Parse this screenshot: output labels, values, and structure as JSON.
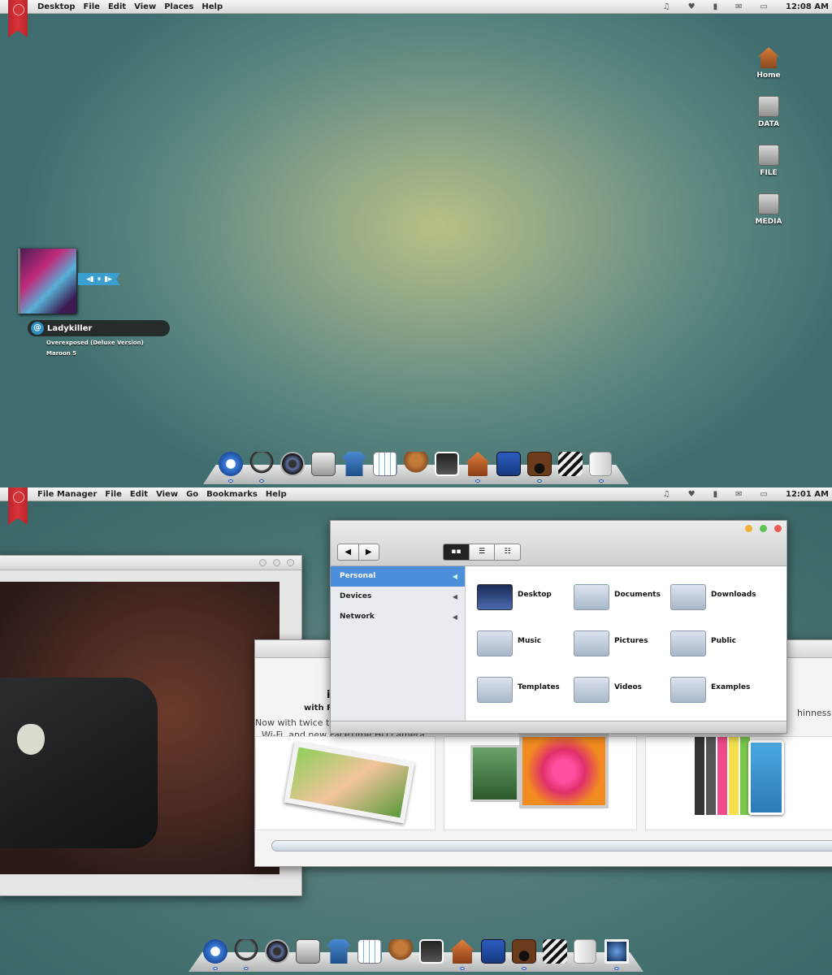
{
  "screen1": {
    "menubar": {
      "items": [
        "Desktop",
        "File",
        "Edit",
        "View",
        "Places",
        "Help"
      ],
      "tray_icons": [
        "music-icon",
        "heart-icon",
        "signal-icon",
        "mail-icon",
        "chat-icon"
      ],
      "clock": "12:08 AM"
    },
    "desktop_icons": [
      {
        "label": "Home",
        "icon": "home-folder-icon"
      },
      {
        "label": "DATA",
        "icon": "drive-icon"
      },
      {
        "label": "FILE",
        "icon": "drive-icon"
      },
      {
        "label": "MEDIA",
        "icon": "drive-icon"
      }
    ],
    "music_widget": {
      "track": "Ladykiller",
      "album": "Overexposed (Deluxe Version)",
      "artist": "Maroon 5",
      "controls": [
        "previous-icon",
        "pause-icon",
        "next-icon"
      ]
    },
    "dock": {
      "items": [
        "safari-icon",
        "headphones-icon",
        "webcam-icon",
        "window-manager-icon",
        "shirt-icon",
        "calendar-grid-icon",
        "teddy-bear-icon",
        "photos-icon",
        "home-icon",
        "superman-book-icon",
        "speaker-icon",
        "clapperboard-icon",
        "switch-icon"
      ],
      "running": [
        0,
        1,
        8,
        10,
        12
      ]
    }
  },
  "screen2": {
    "menubar": {
      "items": [
        "File Manager",
        "File",
        "Edit",
        "View",
        "Go",
        "Bookmarks",
        "Help"
      ],
      "tray_icons": [
        "music-icon",
        "heart-icon",
        "signal-icon",
        "mail-icon",
        "chat-icon"
      ],
      "clock": "12:01 AM"
    },
    "store_window": {
      "headline_partial": "iP",
      "subhead_partial": "with Re",
      "body_line1": "Now with twice th",
      "body_line2": "Wi-Fi, and new FaceTime HD camera.",
      "right_text": "hinness."
    },
    "file_manager": {
      "nav": [
        "back-arrow-icon",
        "forward-arrow-icon"
      ],
      "view_modes": [
        "icon-view-icon",
        "list-view-icon",
        "compact-view-icon"
      ],
      "sidebar": [
        {
          "label": "Personal",
          "selected": true
        },
        {
          "label": "Devices",
          "selected": false
        },
        {
          "label": "Network",
          "selected": false
        }
      ],
      "folders": [
        {
          "label": "Desktop",
          "icon": "desktop-folder-icon"
        },
        {
          "label": "Documents",
          "icon": "documents-folder-icon"
        },
        {
          "label": "Downloads",
          "icon": "downloads-folder-icon"
        },
        {
          "label": "Music",
          "icon": "music-folder-icon"
        },
        {
          "label": "Pictures",
          "icon": "pictures-folder-icon"
        },
        {
          "label": "Public",
          "icon": "public-folder-icon"
        },
        {
          "label": "Templates",
          "icon": "templates-folder-icon"
        },
        {
          "label": "Videos",
          "icon": "videos-folder-icon"
        },
        {
          "label": "Examples",
          "icon": "examples-folder-icon"
        }
      ]
    },
    "dock": {
      "items": [
        "safari-icon",
        "headphones-icon",
        "webcam-icon",
        "window-manager-icon",
        "shirt-icon",
        "calendar-grid-icon",
        "teddy-bear-icon",
        "photos-icon",
        "home-icon",
        "superman-book-icon",
        "speaker-icon",
        "clapperboard-icon",
        "switch-icon",
        "preview-icon"
      ],
      "running": [
        0,
        1,
        8,
        10,
        13
      ]
    }
  },
  "colors": {
    "accent_selection": "#4b8fda",
    "ribbon_red": "#c62f35",
    "window_close": "#ee5a54",
    "window_min": "#f0b13a",
    "window_max": "#5dc355"
  }
}
